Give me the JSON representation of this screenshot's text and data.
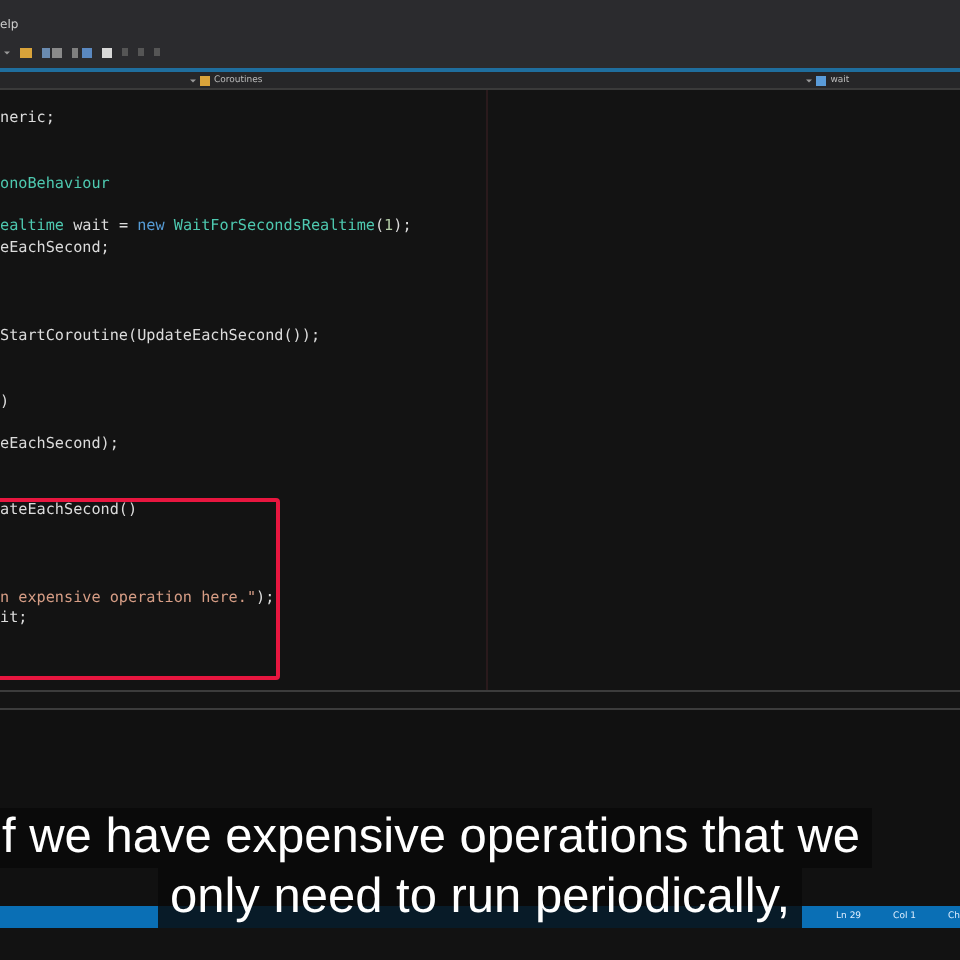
{
  "menu": {
    "item": "elp"
  },
  "nav_bar": {
    "class_dropdown": "Coroutines",
    "member_dropdown": "wait"
  },
  "code_lines": [
    {
      "kind": "code",
      "tokens": [
        {
          "text": "neric;",
          "kind": "plain"
        }
      ]
    },
    {
      "kind": "blank"
    },
    {
      "kind": "blank"
    },
    {
      "kind": "code",
      "tokens": [
        {
          "text": "onoBehaviour",
          "kind": "type"
        }
      ]
    },
    {
      "kind": "blank"
    },
    {
      "kind": "code",
      "tokens": [
        {
          "text": "ealtime",
          "kind": "type"
        },
        {
          "text": " wait = ",
          "kind": "plain"
        },
        {
          "text": "new",
          "kind": "keyword"
        },
        {
          "text": " WaitForSecondsRealtime",
          "kind": "type"
        },
        {
          "text": "(",
          "kind": "plain"
        },
        {
          "text": "1",
          "kind": "number"
        },
        {
          "text": ");",
          "kind": "plain"
        }
      ]
    },
    {
      "kind": "code",
      "tokens": [
        {
          "text": "eEachSecond;",
          "kind": "plain"
        }
      ]
    },
    {
      "kind": "blank"
    },
    {
      "kind": "blank"
    },
    {
      "kind": "blank"
    },
    {
      "kind": "code",
      "tokens": [
        {
          "text": "StartCoroutine(UpdateEachSecond());",
          "kind": "plain"
        }
      ]
    },
    {
      "kind": "blank"
    },
    {
      "kind": "blank"
    },
    {
      "kind": "code",
      "tokens": [
        {
          "text": ")",
          "kind": "plain"
        }
      ]
    },
    {
      "kind": "blank"
    },
    {
      "kind": "code",
      "tokens": [
        {
          "text": "eEachSecond);",
          "kind": "plain"
        }
      ]
    },
    {
      "kind": "blank"
    },
    {
      "kind": "blank"
    },
    {
      "kind": "code",
      "tokens": [
        {
          "text": "ateEachSecond()",
          "kind": "plain"
        }
      ]
    },
    {
      "kind": "blank"
    },
    {
      "kind": "blank"
    },
    {
      "kind": "blank"
    },
    {
      "kind": "code",
      "tokens": [
        {
          "text": "n expensive operation here.\"",
          "kind": "string"
        },
        {
          "text": ");",
          "kind": "plain"
        }
      ]
    },
    {
      "kind": "code",
      "tokens": [
        {
          "text": "it;",
          "kind": "plain"
        }
      ]
    }
  ],
  "status_bar": [
    "Ln 29",
    "Col 1",
    "Ch"
  ],
  "subtitles": [
    "f we have expensive operations that we",
    "only need to run periodically,"
  ]
}
